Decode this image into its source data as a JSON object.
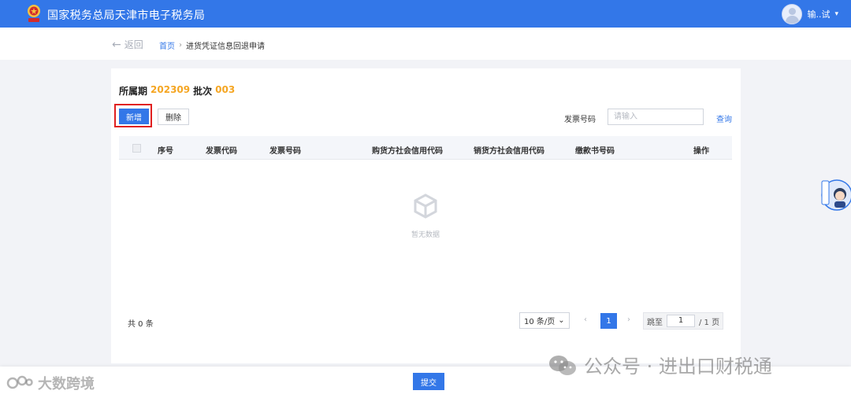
{
  "header": {
    "title": "国家税务总局天津市电子税务局",
    "user_name": "输..试"
  },
  "breadcrumb": {
    "back_label": "返回",
    "home": "首页",
    "current": "进货凭证信息回退申请"
  },
  "period": {
    "period_label": "所属期",
    "period_value": "202309",
    "batch_label": "批次",
    "batch_value": "003"
  },
  "toolbar": {
    "add_label": "新增",
    "delete_label": "删除",
    "search_label": "发票号码",
    "search_placeholder": "请输入",
    "query_label": "查询"
  },
  "table": {
    "columns": [
      "序号",
      "发票代码",
      "发票号码",
      "购货方社会信用代码",
      "销货方社会信用代码",
      "缴款书号码",
      "操作"
    ],
    "rows": [],
    "empty_text": "暂无数据"
  },
  "pagination": {
    "total": "共 0 条",
    "page_size": "10 条/页",
    "current_page": "1",
    "jump_label": "跳至",
    "jump_value": "1",
    "page_total": "/ 1 页"
  },
  "footer": {
    "submit_label": "提交"
  },
  "watermarks": {
    "left": "大数跨境",
    "right": "公众号 · 进出口财税通"
  },
  "colors": {
    "primary": "#3377e8",
    "highlight": "#f5a623",
    "annotation": "#e02020"
  }
}
